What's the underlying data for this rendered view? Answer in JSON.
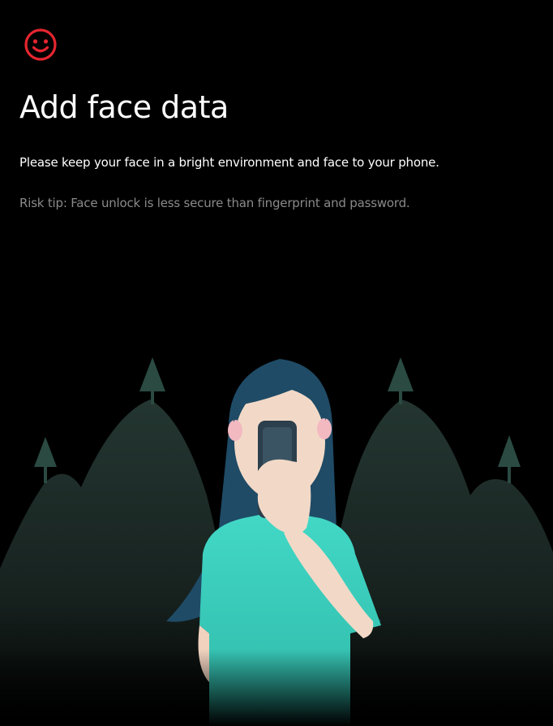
{
  "header": {
    "icon": "smiley-face-icon",
    "accent_color": "#e5252f",
    "title": "Add face data"
  },
  "content": {
    "instruction": "Please keep your face in a bright environment and face to your phone.",
    "risk_tip": "Risk tip: Face unlock is less secure than fingerprint and password."
  },
  "illustration": {
    "subject": "person-holding-phone-illustration",
    "shirt_color": "#3fd6c4",
    "hair_color": "#1f4b66",
    "skin_color": "#f2d9c7",
    "phone_color": "#2c3f4c",
    "mountain_color": "#1c2a26",
    "tree_color": "#2a4a42"
  }
}
